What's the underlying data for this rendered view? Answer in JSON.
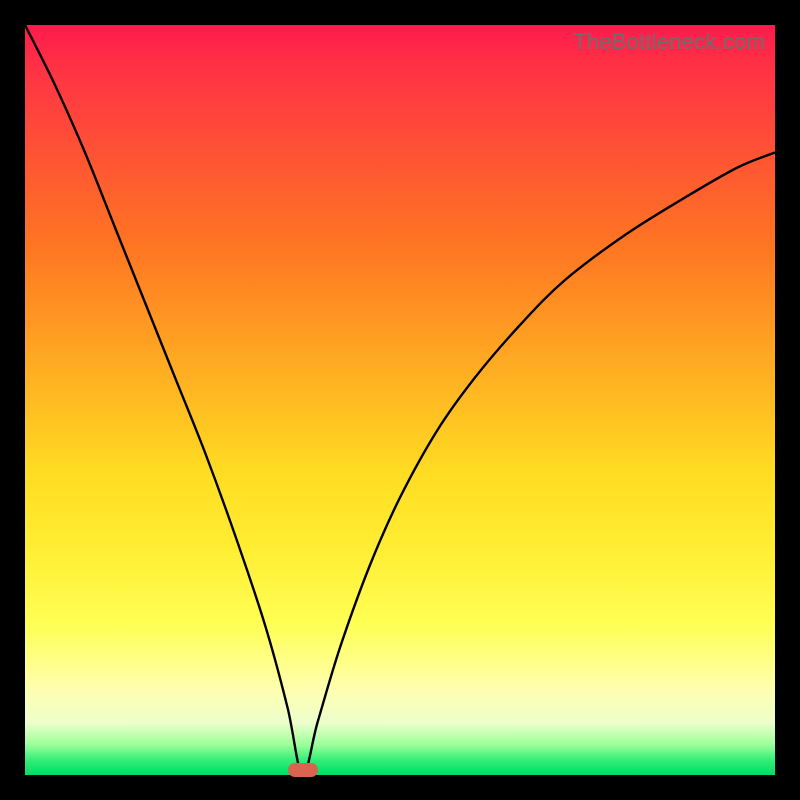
{
  "watermark": "TheBottleneck.com",
  "colors": {
    "frame": "#000000",
    "curve": "#000000",
    "marker": "#d9644f",
    "gradient_top": "#ff1a4d",
    "gradient_bottom": "#00dd66"
  },
  "chart_data": {
    "type": "line",
    "title": "",
    "xlabel": "",
    "ylabel": "",
    "xlim": [
      0,
      100
    ],
    "ylim": [
      0,
      100
    ],
    "legend": false,
    "grid": false,
    "annotations": [
      {
        "text": "TheBottleneck.com",
        "position": "top-right"
      }
    ],
    "marker": {
      "x": 37,
      "width_pct": 4
    },
    "series": [
      {
        "name": "bottleneck-curve",
        "x": [
          0,
          4,
          8,
          12,
          16,
          20,
          24,
          28,
          32,
          35,
          37,
          39,
          42,
          46,
          50,
          55,
          60,
          66,
          72,
          80,
          88,
          95,
          100
        ],
        "values": [
          100,
          92,
          83,
          73,
          63,
          53,
          43,
          32,
          20,
          9,
          0,
          7,
          17,
          28,
          37,
          46,
          53,
          60,
          66,
          72,
          77,
          81,
          83
        ]
      }
    ]
  }
}
